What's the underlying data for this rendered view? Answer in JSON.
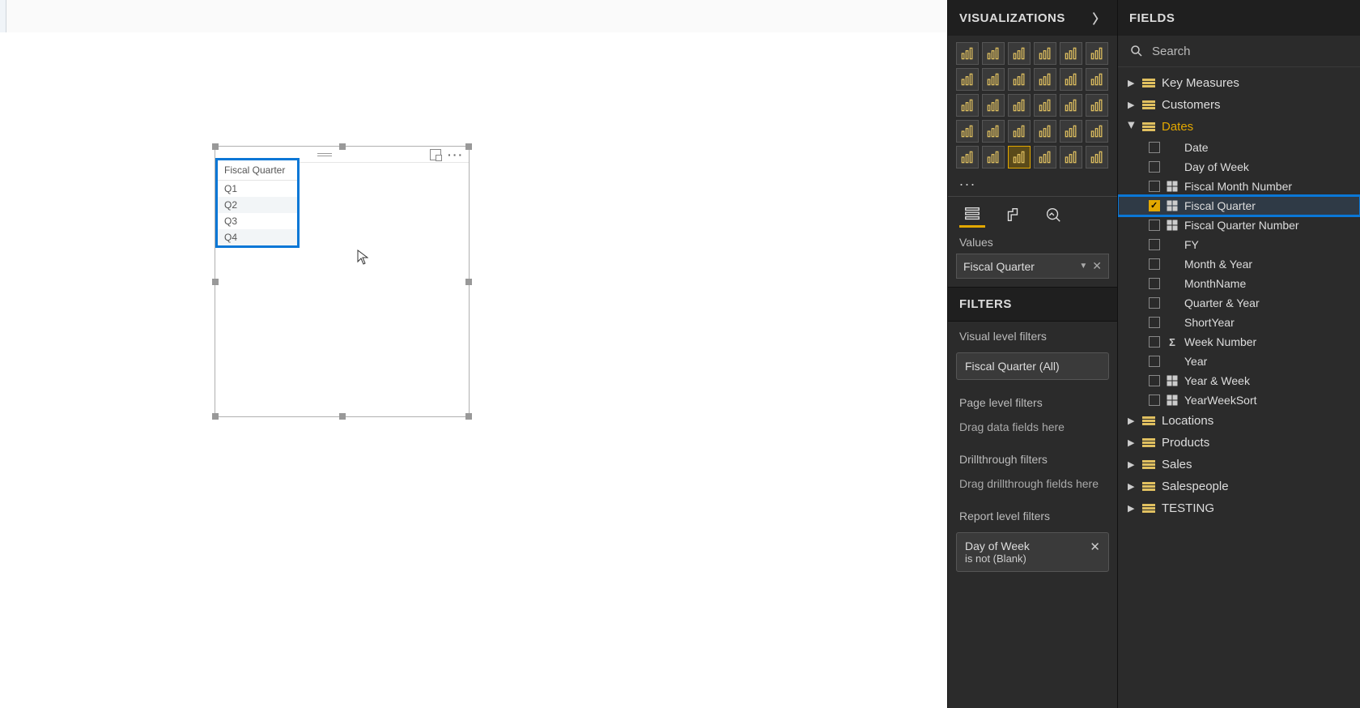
{
  "canvas": {
    "table_header": "Fiscal Quarter",
    "rows": [
      "Q1",
      "Q2",
      "Q3",
      "Q4"
    ]
  },
  "viz": {
    "title": "VISUALIZATIONS",
    "chart_titles": [
      "stacked-bar",
      "clustered-bar",
      "stacked-column",
      "clustered-column",
      "100-stacked-bar",
      "100-stacked-column",
      "line",
      "area",
      "stacked-area",
      "line-clustered-column",
      "line-stacked-column",
      "ribbon",
      "waterfall",
      "scatter",
      "pie",
      "donut",
      "treemap",
      "map",
      "filled-map",
      "funnel",
      "gauge",
      "card",
      "multi-row-card",
      "kpi",
      "slicer",
      "table",
      "matrix",
      "r-script",
      "py-script",
      "arcgis"
    ],
    "selected_chart_index": 26,
    "more": "...",
    "tabs": [
      "fields",
      "format",
      "analytics"
    ],
    "selected_tab": 0,
    "values_label": "Values",
    "value_field": "Fiscal Quarter",
    "filters_title": "FILTERS",
    "visual_filters_label": "Visual level filters",
    "visual_filter_text": "Fiscal Quarter (All)",
    "page_filters_label": "Page level filters",
    "page_drop_hint": "Drag data fields here",
    "drill_label": "Drillthrough filters",
    "drill_drop_hint": "Drag drillthrough fields here",
    "report_filters_label": "Report level filters",
    "report_filter_name": "Day of Week",
    "report_filter_cond": "is not (Blank)"
  },
  "fields": {
    "title": "FIELDS",
    "search_placeholder": "Search",
    "tables": [
      {
        "name": "Key Measures",
        "expanded": false
      },
      {
        "name": "Customers",
        "expanded": false
      },
      {
        "name": "Dates",
        "expanded": true,
        "fields": [
          {
            "name": "Date",
            "checked": false,
            "icon": "none"
          },
          {
            "name": "Day of Week",
            "checked": false,
            "icon": "none"
          },
          {
            "name": "Fiscal Month Number",
            "checked": false,
            "icon": "hier"
          },
          {
            "name": "Fiscal Quarter",
            "checked": true,
            "icon": "hier",
            "highlight": true
          },
          {
            "name": "Fiscal Quarter Number",
            "checked": false,
            "icon": "hier"
          },
          {
            "name": "FY",
            "checked": false,
            "icon": "none"
          },
          {
            "name": "Month & Year",
            "checked": false,
            "icon": "none"
          },
          {
            "name": "MonthName",
            "checked": false,
            "icon": "none"
          },
          {
            "name": "Quarter & Year",
            "checked": false,
            "icon": "none"
          },
          {
            "name": "ShortYear",
            "checked": false,
            "icon": "none"
          },
          {
            "name": "Week Number",
            "checked": false,
            "icon": "sigma"
          },
          {
            "name": "Year",
            "checked": false,
            "icon": "none"
          },
          {
            "name": "Year & Week",
            "checked": false,
            "icon": "hier"
          },
          {
            "name": "YearWeekSort",
            "checked": false,
            "icon": "hier"
          }
        ]
      },
      {
        "name": "Locations",
        "expanded": false
      },
      {
        "name": "Products",
        "expanded": false
      },
      {
        "name": "Sales",
        "expanded": false
      },
      {
        "name": "Salespeople",
        "expanded": false
      },
      {
        "name": "TESTING",
        "expanded": false
      }
    ]
  }
}
